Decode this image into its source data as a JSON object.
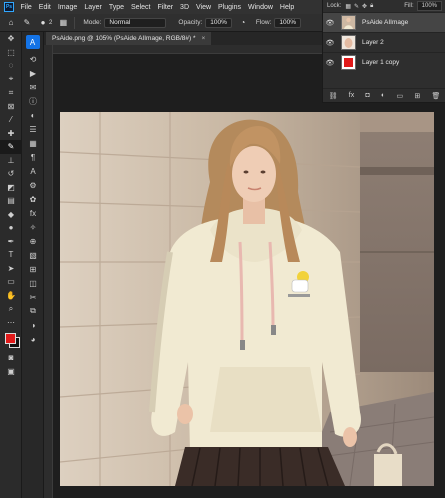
{
  "menubar": {
    "logo": "Ps",
    "items": [
      "File",
      "Edit",
      "Image",
      "Layer",
      "Type",
      "Select",
      "Filter",
      "3D",
      "View",
      "Plugins",
      "Window",
      "Help"
    ]
  },
  "options": {
    "brush_size": "2",
    "mode_label": "Mode:",
    "mode_value": "Normal",
    "opacity_label": "Opacity:",
    "opacity_value": "100%",
    "flow_label": "Flow:",
    "flow_value": "100%"
  },
  "document": {
    "tab_title": "PsAide.png @ 105% (PsAide AIImage, RGB/8#) *",
    "close_glyph": "×"
  },
  "layers": {
    "lock_label": "Lock:",
    "fill_label": "Fill:",
    "fill_value": "100%",
    "items": [
      {
        "name": "PsAide AIImage",
        "selected": true
      },
      {
        "name": "Layer 2",
        "selected": false
      },
      {
        "name": "Layer 1 copy",
        "selected": false
      }
    ],
    "footer_fx": "fx"
  },
  "colors": {
    "foreground": "#e11a1a",
    "background": "#111111",
    "accent": "#1473e6"
  }
}
